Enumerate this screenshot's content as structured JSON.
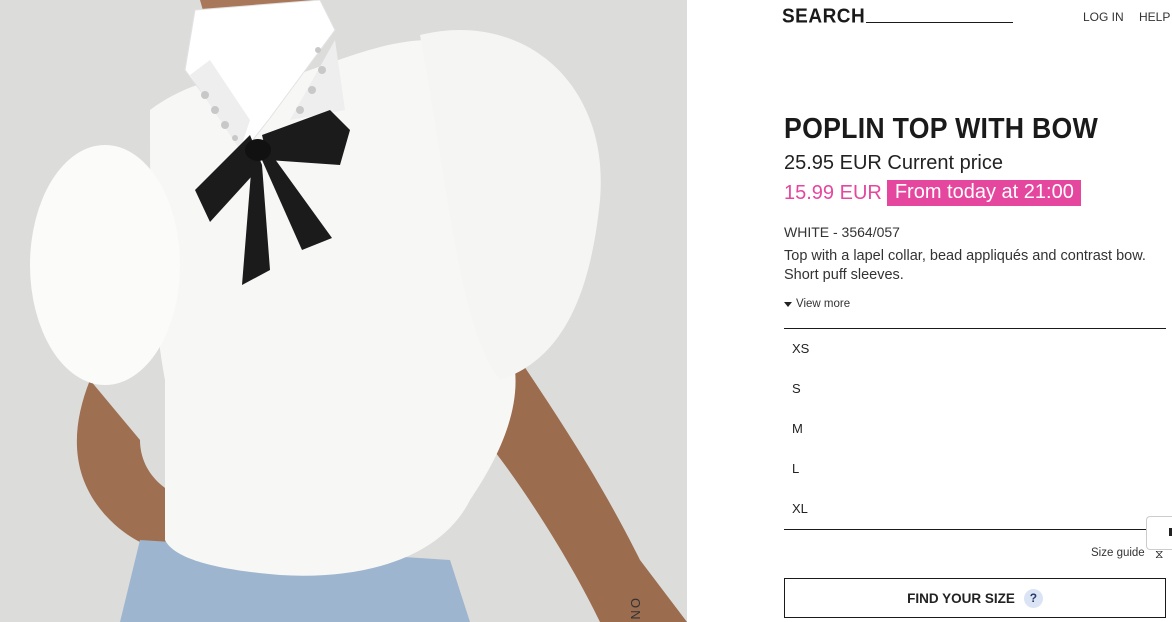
{
  "header": {
    "search_label": "SEARCH",
    "login_label": "LOG IN",
    "help_label": "HELP"
  },
  "product": {
    "title": "POPLIN TOP WITH BOW",
    "current_price": "25.95 EUR Current price",
    "sale_price": "15.99 EUR",
    "sale_badge": "From today at 21:00",
    "color_ref": "WHITE - 3564/057",
    "description": "Top with a lapel collar, bead appliqués and contrast bow. Short puff sleeves.",
    "view_more_label": "View more"
  },
  "sizes": [
    "XS",
    "S",
    "M",
    "L",
    "XL"
  ],
  "size_guide_label": "Size guide",
  "find_size_label": "FIND YOUR SIZE",
  "find_size_help": "?",
  "photo_vertical_text": "ON",
  "colors": {
    "sale_accent": "#e5479f",
    "help_badge_bg": "#dbe4f5"
  },
  "icons": [
    "caret-down-icon",
    "ruler-icon",
    "question-icon"
  ]
}
